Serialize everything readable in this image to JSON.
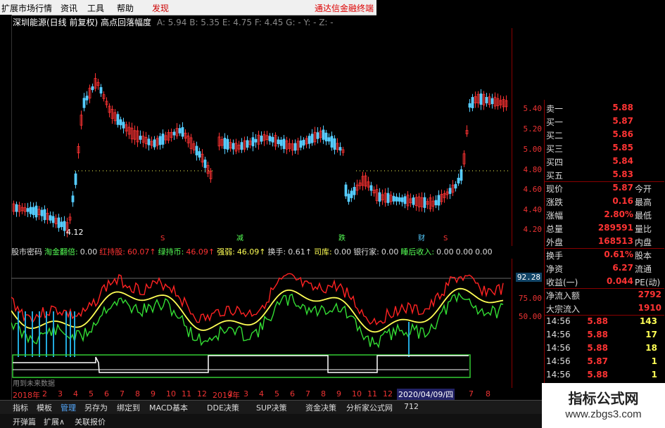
{
  "menu": {
    "items": [
      "扩展市场行情",
      "资讯",
      "工具",
      "帮助",
      "发现"
    ],
    "right_link": "通达信金融终端"
  },
  "chart": {
    "title": "深圳能源(日线 前复权) 高点回落幅度",
    "meta": "A: 5.94  B: 5.35  E: 4.75  F: 4.45  G: -  Y: -  Z: -",
    "low_label": "4.12",
    "marker_labels": [
      "S",
      "减",
      "跌",
      "财",
      "S"
    ],
    "price_ticks": [
      "5.40",
      "5.20",
      "5.00",
      "4.80",
      "4.60",
      "4.40",
      "4.20"
    ]
  },
  "indicator_row": {
    "items": [
      {
        "label": "股市密码",
        "color": "#ddd"
      },
      {
        "label": "淘金翻倍:",
        "color": "#5f5"
      },
      {
        "label": "0.00",
        "color": "#ddd"
      },
      {
        "label": "红持股:",
        "color": "#f33"
      },
      {
        "label": "60.07↑",
        "color": "#f33"
      },
      {
        "label": "绿持币:",
        "color": "#5f5"
      },
      {
        "label": "46.09↑",
        "color": "#f33"
      },
      {
        "label": "强弱:",
        "color": "#ff5"
      },
      {
        "label": "46.09↑",
        "color": "#ff5"
      },
      {
        "label": "换手:",
        "color": "#ddd"
      },
      {
        "label": "0.61↑",
        "color": "#ddd"
      },
      {
        "label": "司库:",
        "color": "#ff5"
      },
      {
        "label": "0.00",
        "color": "#ddd"
      },
      {
        "label": "银行家:",
        "color": "#ddd"
      },
      {
        "label": "0.00",
        "color": "#ddd"
      },
      {
        "label": "睡后收入:",
        "color": "#5f5"
      },
      {
        "label": "0.00",
        "color": "#ddd"
      },
      {
        "label": "0.00",
        "color": "#ddd"
      },
      {
        "label": "0.00",
        "color": "#ddd"
      }
    ],
    "sub_ticks": [
      "92.28",
      "75.00",
      "50.00"
    ],
    "sub_note": "用到未来数据"
  },
  "quote": {
    "orders": [
      {
        "label": "卖一",
        "price": "5.88"
      },
      {
        "label": "买一",
        "price": "5.87"
      },
      {
        "label": "买二",
        "price": "5.86"
      },
      {
        "label": "买三",
        "price": "5.85"
      },
      {
        "label": "买四",
        "price": "5.84"
      },
      {
        "label": "买五",
        "price": "5.83"
      }
    ],
    "stats": [
      {
        "label": "现价",
        "value": "5.87",
        "label2": "今开"
      },
      {
        "label": "涨跌",
        "value": "0.16",
        "label2": "最高"
      },
      {
        "label": "涨幅",
        "value": "2.80%",
        "label2": "最低"
      },
      {
        "label": "总量",
        "value": "289591",
        "label2": "量比"
      },
      {
        "label": "外盘",
        "value": "168513",
        "label2": "内盘"
      }
    ],
    "stats2": [
      {
        "label": "换手",
        "value": "0.61%",
        "label2": "股本"
      },
      {
        "label": "净资",
        "value": "6.27",
        "label2": "流通"
      },
      {
        "label": "收益(一)",
        "value": "0.044",
        "label2": "PE(动)"
      }
    ],
    "flows": [
      {
        "label": "净流入额",
        "value": "2792"
      },
      {
        "label": "大宗流入",
        "value": "1910"
      }
    ],
    "ticks": [
      {
        "time": "14:56",
        "price": "5.88",
        "vol": "143"
      },
      {
        "time": "14:56",
        "price": "5.88",
        "vol": "17"
      },
      {
        "time": "14:56",
        "price": "5.88",
        "vol": "18"
      },
      {
        "time": "14:56",
        "price": "5.87",
        "vol": "1"
      },
      {
        "time": "14:56",
        "price": "5.88",
        "vol": "1"
      }
    ]
  },
  "datebar": {
    "items": [
      "2018年",
      "2",
      "3",
      "4",
      "5",
      "6",
      "7",
      "8",
      "9",
      "10",
      "11",
      "12",
      "2019年",
      "2",
      "3",
      "4",
      "5",
      "6",
      "7",
      "8",
      "9",
      "10",
      "11",
      "12",
      "2"
    ],
    "highlight": "2020/04/09/四",
    "after": [
      "7",
      "8"
    ]
  },
  "tabs": [
    "指标",
    "模板",
    "管理",
    "另存为",
    "绑定到",
    "MACD基本",
    "DDE决策",
    "SUP决策",
    "资金决策",
    "分析家公式网",
    "712"
  ],
  "tabs2": [
    "开弹篇",
    "扩展∧",
    "关联报价"
  ],
  "watermark": {
    "line1": "指标公式网",
    "line2": "www.zbgs3.com"
  },
  "colors": {
    "up": "#f33",
    "down": "#5cf",
    "strong": "#f22",
    "weak": "#3d3",
    "avg": "#ff5",
    "axis": "#8b0000"
  }
}
